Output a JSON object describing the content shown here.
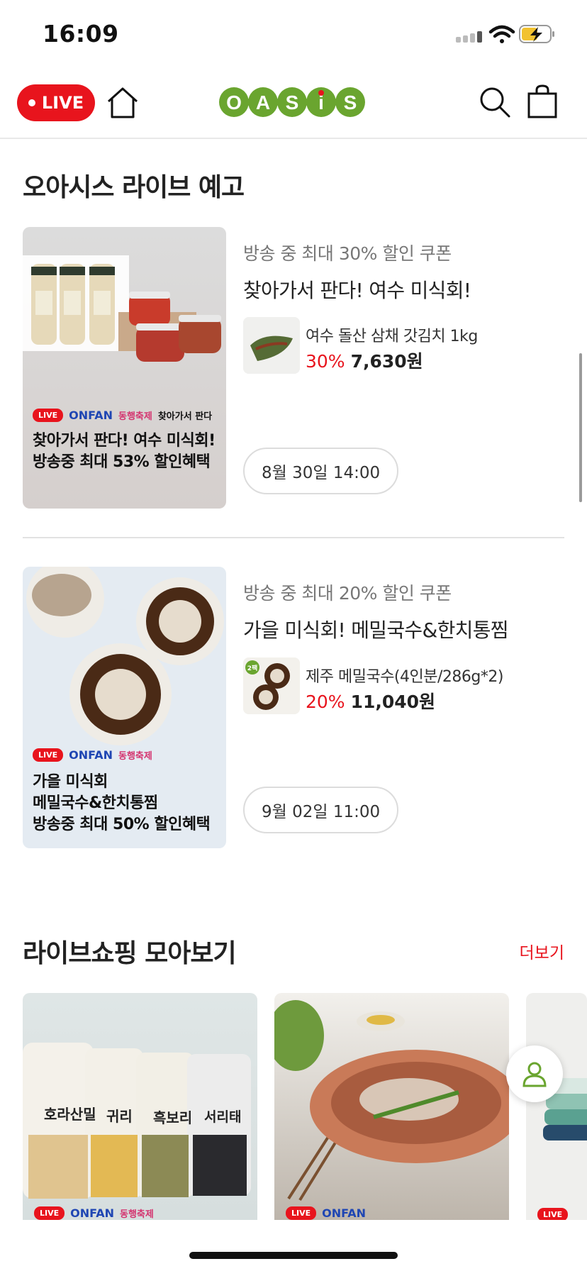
{
  "status_bar": {
    "time": "16:09"
  },
  "header": {
    "live_badge": "LIVE",
    "logo_text": "OASiS",
    "icons": [
      "home-icon",
      "search-icon",
      "shopping-bag-icon"
    ]
  },
  "preview_section": {
    "title": "오아시스 라이브 예고",
    "cards": [
      {
        "coupon": "방송 중 최대 30% 할인 쿠폰",
        "title": "찾아가서 판다! 여수 미식회!",
        "product_name": "여수 돌산 삼채 갓김치 1kg",
        "discount": "30%",
        "price": "7,630원",
        "date": "8월 30일 14:00",
        "thumb_caption_1": "찾아가서 판다! 여수 미식회!",
        "thumb_caption_2": "방송중 최대 53% 할인혜택",
        "thumb_tag": "찾아가서 판다",
        "thumb_badge": "LIVE",
        "thumb_brand": "ONFAN",
        "thumb_festa": "동행축제"
      },
      {
        "coupon": "방송 중 최대 20% 할인 쿠폰",
        "title": "가을 미식회! 메밀국수&한치통찜",
        "product_name": "제주 메밀국수(4인분/286g*2)",
        "discount": "20%",
        "price": "11,040원",
        "date": "9월 02일 11:00",
        "thumb_caption_1": "가을 미식회",
        "thumb_caption_2": "메밀국수&한치통찜",
        "thumb_caption_3": "방송중 최대 50% 할인혜택",
        "thumb_badge": "LIVE",
        "thumb_brand": "ONFAN",
        "thumb_festa": "동행축제",
        "prod_tag": "2팩"
      }
    ]
  },
  "live_shopping_section": {
    "title": "라이브쇼핑 모아보기",
    "more": "더보기",
    "cards": [
      {
        "badge": "LIVE",
        "brand": "ONFAN",
        "festa": "동행축제",
        "labels": [
          "호라산밀",
          "귀리",
          "흑보리",
          "서리태"
        ]
      },
      {
        "badge": "LIVE",
        "brand": "ONFAN"
      },
      {
        "badge": "LIVE"
      }
    ]
  },
  "colors": {
    "accent_red": "#e8141d",
    "logo_green": "#6aa52f"
  }
}
